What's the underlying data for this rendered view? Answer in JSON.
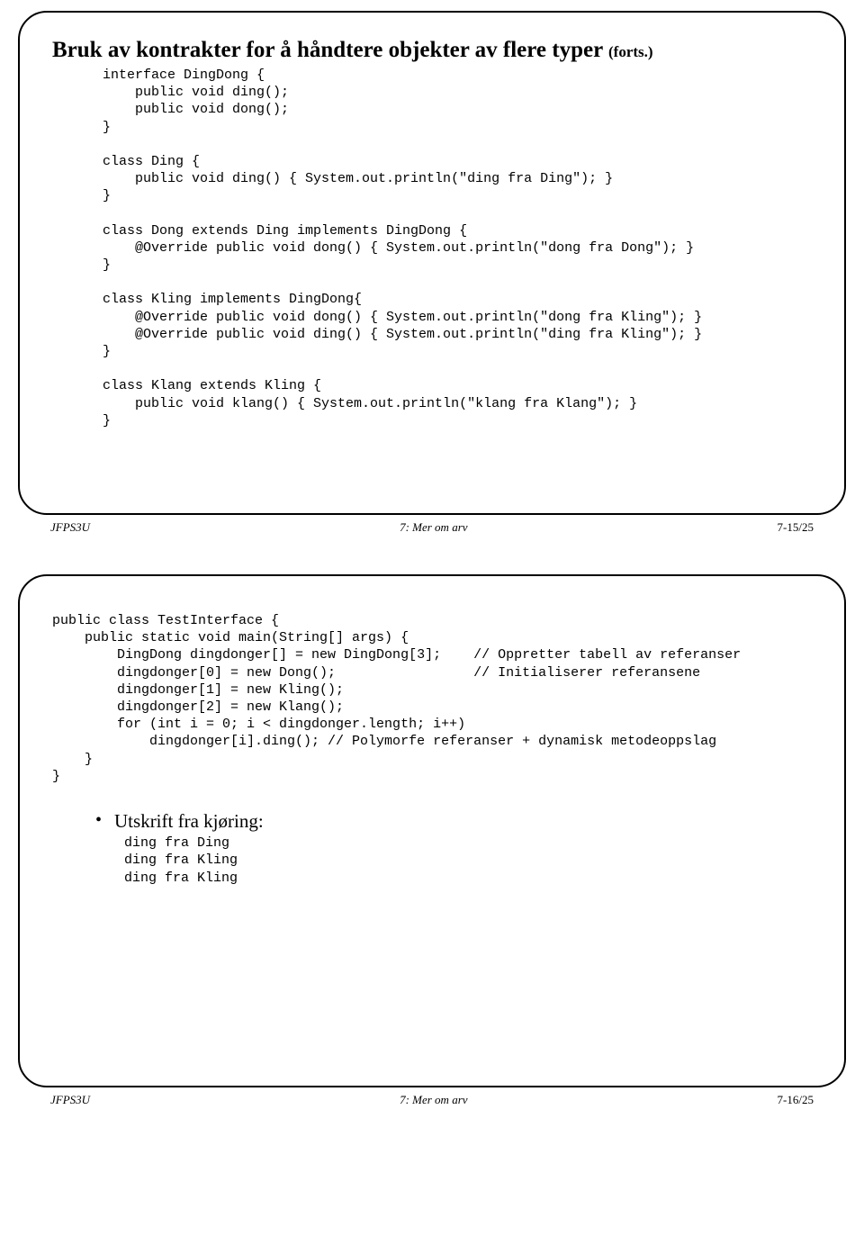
{
  "slide1": {
    "title_main": "Bruk av kontrakter for å håndtere objekter av flere typer ",
    "title_suffix": "(forts.)",
    "code": "interface DingDong {\n    public void ding();\n    public void dong();\n}\n\nclass Ding {\n    public void ding() { System.out.println(\"ding fra Ding\"); }\n}\n\nclass Dong extends Ding implements DingDong {\n    @Override public void dong() { System.out.println(\"dong fra Dong\"); }\n}\n\nclass Kling implements DingDong{\n    @Override public void dong() { System.out.println(\"dong fra Kling\"); }\n    @Override public void ding() { System.out.println(\"ding fra Kling\"); }\n}\n\nclass Klang extends Kling {\n    public void klang() { System.out.println(\"klang fra Klang\"); }\n}",
    "footer_left": "JFPS3U",
    "footer_mid": "7: Mer om arv",
    "footer_right": "7-15/25"
  },
  "slide2": {
    "code": "public class TestInterface {\n    public static void main(String[] args) {\n        DingDong dingdonger[] = new DingDong[3];    // Oppretter tabell av referanser\n        dingdonger[0] = new Dong();                 // Initialiserer referansene\n        dingdonger[1] = new Kling();\n        dingdonger[2] = new Klang();\n        for (int i = 0; i < dingdonger.length; i++)\n            dingdonger[i].ding(); // Polymorfe referanser + dynamisk metodeoppslag\n    }\n}",
    "bullet_label": "Utskrift fra kjøring:",
    "output_lines": [
      "ding fra Ding",
      "ding fra Kling",
      "ding fra Kling"
    ],
    "footer_left": "JFPS3U",
    "footer_mid": "7: Mer om arv",
    "footer_right": "7-16/25"
  }
}
